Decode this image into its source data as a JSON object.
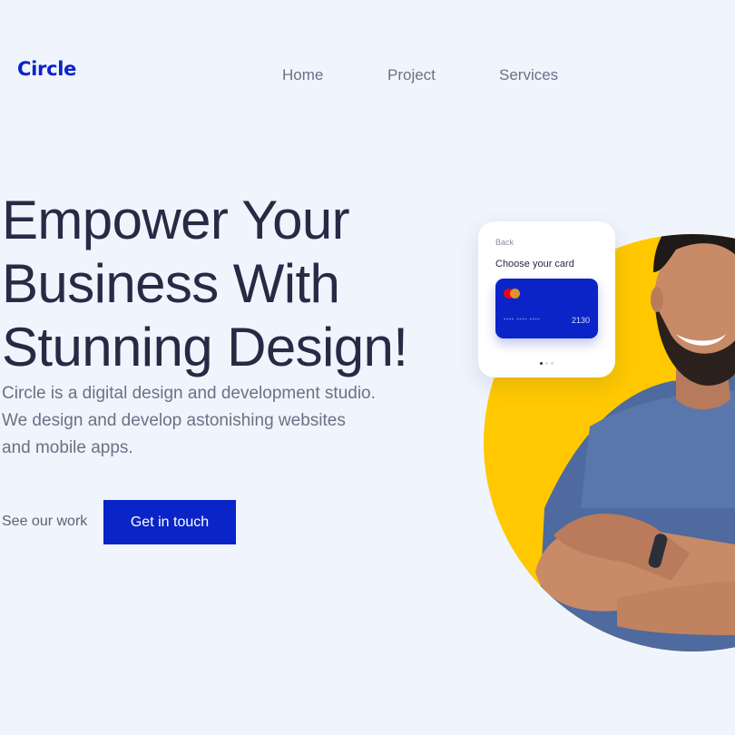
{
  "brand": {
    "logo": "Circle",
    "accent_color": "#0a24c7",
    "highlight_color": "#ffc800"
  },
  "nav": {
    "items": [
      "Home",
      "Project",
      "Services"
    ]
  },
  "hero": {
    "headline_lines": [
      "Empower Your",
      "Business With",
      "Stunning Design!"
    ],
    "subtext_lines": [
      "Circle is a digital design and development studio.",
      "We design and develop astonishing websites",
      "and mobile apps."
    ],
    "secondary_cta": "See our work",
    "primary_cta": "Get in touch"
  },
  "payment_card": {
    "back_label": "Back",
    "title": "Choose your card",
    "masked_number": "•••• •••• ••••",
    "last_digits": "2130",
    "card_brand_icon": "mastercard-icon",
    "pager_dots": 3,
    "active_dot": 1
  },
  "illustration": {
    "subject": "person-photo"
  }
}
